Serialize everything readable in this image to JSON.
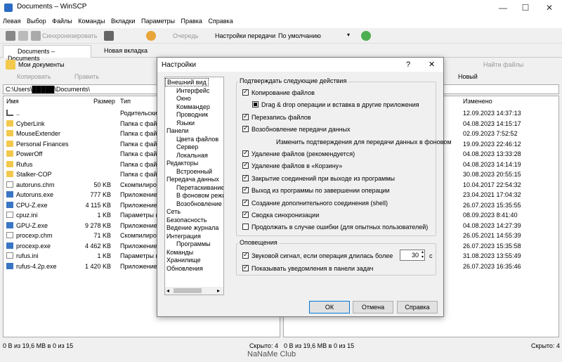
{
  "window": {
    "title": "Documents – WinSCP",
    "minimize": "—",
    "maximize": "☐",
    "close": "✕"
  },
  "menu": [
    "Левая",
    "Выбор",
    "Файлы",
    "Команды",
    "Вкладки",
    "Параметры",
    "Правка",
    "Справка"
  ],
  "toolbar": {
    "sync": "Синхронизировать",
    "queue": "Очередь",
    "transfer_label": "Настройки передачи",
    "transfer_value": "По умолчанию"
  },
  "tabs": {
    "active": "Documents – Documents",
    "new": "Новая вкладка"
  },
  "left_panel": {
    "location": "Мои документы",
    "copy": "Копировать",
    "edit": "Править",
    "path": "C:\\Users\\█████\\Documents\\",
    "columns": [
      "Имя",
      "Размер",
      "Тип"
    ],
    "rows": [
      {
        "name": "..",
        "size": "",
        "type": "Родительский",
        "icon": "up"
      },
      {
        "name": "CyberLink",
        "size": "",
        "type": "Папка с файл",
        "icon": "folder"
      },
      {
        "name": "MouseExtender",
        "size": "",
        "type": "Папка с файл",
        "icon": "folder"
      },
      {
        "name": "Personal Finances",
        "size": "",
        "type": "Папка с файл",
        "icon": "folder"
      },
      {
        "name": "PowerOff",
        "size": "",
        "type": "Папка с файл",
        "icon": "folder"
      },
      {
        "name": "Rufus",
        "size": "",
        "type": "Папка с файл",
        "icon": "folder"
      },
      {
        "name": "Stalker-COP",
        "size": "",
        "type": "Папка с файл",
        "icon": "folder"
      },
      {
        "name": "autoruns.chm",
        "size": "50 KB",
        "type": "Скомпилиров",
        "icon": "file"
      },
      {
        "name": "Autoruns.exe",
        "size": "777 KB",
        "type": "Приложение",
        "icon": "exe"
      },
      {
        "name": "CPU-Z.exe",
        "size": "4 115 KB",
        "type": "Приложение",
        "icon": "exe"
      },
      {
        "name": "cpuz.ini",
        "size": "1 KB",
        "type": "Параметры ко",
        "icon": "file"
      },
      {
        "name": "GPU-Z.exe",
        "size": "9 278 KB",
        "type": "Приложение",
        "icon": "exe"
      },
      {
        "name": "procexp.chm",
        "size": "71 KB",
        "type": "Скомпилиров",
        "icon": "file"
      },
      {
        "name": "procexp.exe",
        "size": "4 462 KB",
        "type": "Приложение",
        "icon": "exe"
      },
      {
        "name": "rufus.ini",
        "size": "1 KB",
        "type": "Параметры ко",
        "icon": "file"
      },
      {
        "name": "rufus-4.2p.exe",
        "size": "1 420 KB",
        "type": "Приложение",
        "icon": "exe"
      }
    ],
    "status": "0 B из 19,6 MB в 0 из 15",
    "hidden": "Скрыто: 4"
  },
  "right_panel": {
    "find": "Найти файлы",
    "new": "Новый",
    "column": "Изменено",
    "dates": [
      "12.09.2023 14:37:13",
      "04.08.2023 14:15:17",
      "02.09.2023 7:52:52",
      "19.09.2023 22:46:12",
      "04.08.2023 13:33:28",
      "04.08.2023 14:14:19",
      "30.08.2023 20:55:15",
      "10.04.2017 22:54:32",
      "23.04.2021 17:04:32",
      "26.07.2023 15:35:55",
      "08.09.2023 8:41:40",
      "04.08.2023 14:27:39",
      "26.05.2021 14:55:39",
      "26.07.2023 15:35:58",
      "31.08.2023 13:55:49",
      "26.07.2023 16:35:46"
    ],
    "status": "0 B из 19,6 MB в 0 из 15",
    "hidden": "Скрыто: 4"
  },
  "watermark": "NaNaMe Club",
  "dialog": {
    "title": "Настройки",
    "help_glyph": "?",
    "close_glyph": "✕",
    "tree": [
      {
        "label": "Внешний вид",
        "level": 0,
        "selected": true
      },
      {
        "label": "Интерфейс",
        "level": 1
      },
      {
        "label": "Окно",
        "level": 1
      },
      {
        "label": "Коммандер",
        "level": 1
      },
      {
        "label": "Проводник",
        "level": 1
      },
      {
        "label": "Языки",
        "level": 1
      },
      {
        "label": "Панели",
        "level": 0
      },
      {
        "label": "Цвета файлов",
        "level": 1
      },
      {
        "label": "Сервер",
        "level": 1
      },
      {
        "label": "Локальная",
        "level": 1
      },
      {
        "label": "Редакторы",
        "level": 0
      },
      {
        "label": "Встроенный",
        "level": 1
      },
      {
        "label": "Передача данных",
        "level": 0
      },
      {
        "label": "Перетаскивание",
        "level": 1
      },
      {
        "label": "В фоновом режим",
        "level": 1
      },
      {
        "label": "Возобновление",
        "level": 1
      },
      {
        "label": "Сеть",
        "level": 0
      },
      {
        "label": "Безопасность",
        "level": 0
      },
      {
        "label": "Ведение журнала",
        "level": 0
      },
      {
        "label": "Интеграция",
        "level": 0
      },
      {
        "label": "Программы",
        "level": 1
      },
      {
        "label": "Команды",
        "level": 0
      },
      {
        "label": "Хранилище",
        "level": 0
      },
      {
        "label": "Обновления",
        "level": 0
      }
    ],
    "confirm_group": "Подтверждать следующие действия",
    "confirm_options": [
      {
        "label": "Копирование файлов",
        "state": "on",
        "indent": 0
      },
      {
        "label": "Drag & drop операции и вставка в другие приложения",
        "state": "ind",
        "indent": 1
      },
      {
        "label": "Перезапись файлов",
        "state": "on",
        "indent": 0
      },
      {
        "label": "Возобновление передачи данных",
        "state": "on",
        "indent": 0
      },
      {
        "label": "Изменить подтверждения для передачи данных в фоновом",
        "state": "none",
        "indent": 2
      },
      {
        "label": "Удаление файлов (рекомендуется)",
        "state": "on",
        "indent": 0
      },
      {
        "label": "Удаление файлов в «Корзину»",
        "state": "on",
        "indent": 0
      },
      {
        "label": "Закрытие соединений при выходе из программы",
        "state": "on",
        "indent": 0
      },
      {
        "label": "Выход из программы по завершении операции",
        "state": "on",
        "indent": 0
      },
      {
        "label": "Создание дополнительного соединения (shell)",
        "state": "on",
        "indent": 0
      },
      {
        "label": "Сводка синхронизации",
        "state": "on",
        "indent": 0
      },
      {
        "label": "Продолжать в случае ошибки (для опытных пользователей)",
        "state": "off",
        "indent": 0
      }
    ],
    "notify_group": "Оповещения",
    "notify_sound": "Звуковой сигнал, если операция длилась более",
    "notify_sound_value": "30",
    "notify_sound_unit": "с",
    "notify_taskbar": "Показывать уведомления в панели задач",
    "ok": "ОК",
    "cancel": "Отмена",
    "help": "Справка"
  }
}
